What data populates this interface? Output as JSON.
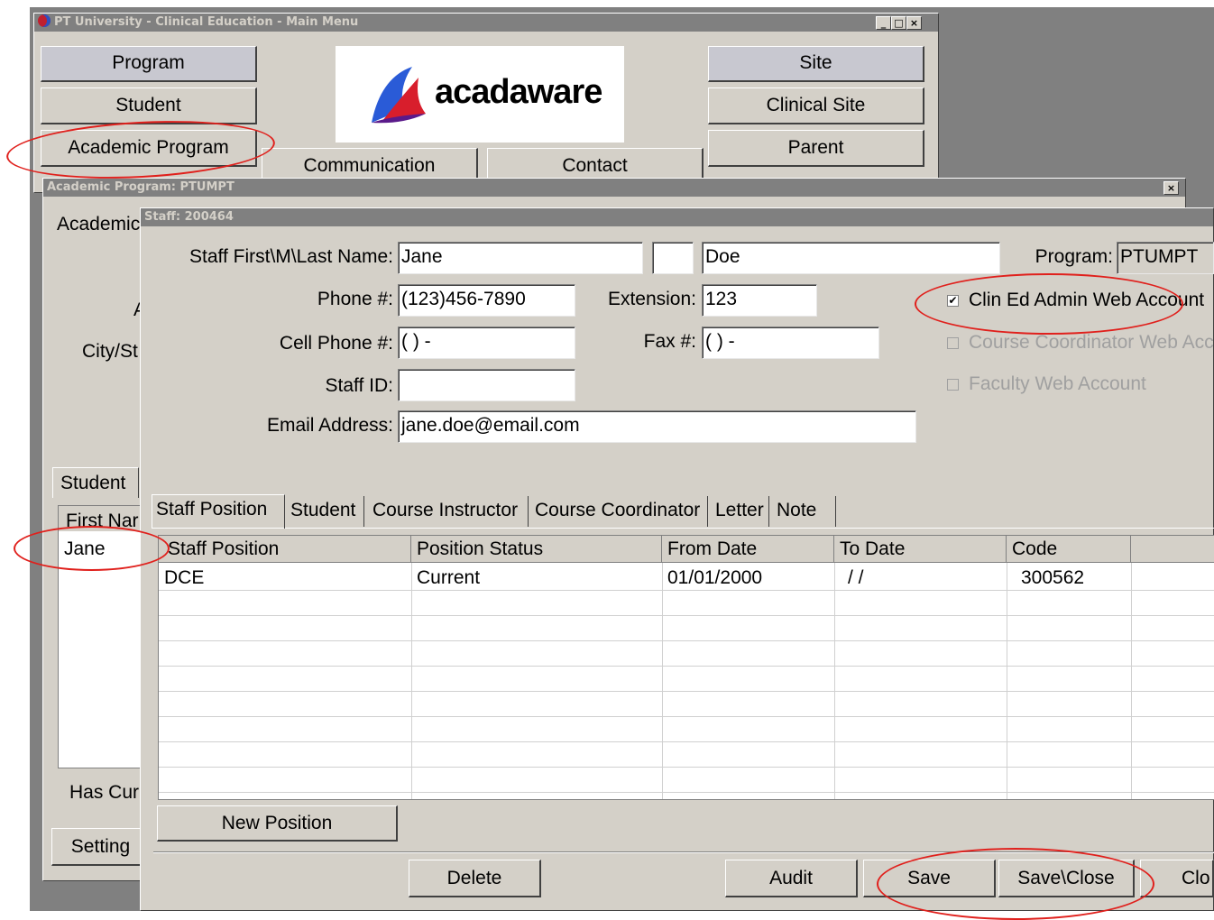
{
  "main_window": {
    "title": "PT University - Clinical Education - Main Menu",
    "buttons": {
      "program": "Program",
      "student": "Student",
      "academic_program": "Academic Program",
      "communication": "Communication",
      "contact": "Contact",
      "site": "Site",
      "clinical_site": "Clinical Site",
      "parent": "Parent"
    },
    "logo_text": "acadaware"
  },
  "academic_window": {
    "title": "Academic Program: PTUMPT",
    "labels": {
      "academic": "Academic",
      "a": "A",
      "city_state": "City/St",
      "has_current": "Has Cur"
    },
    "tab_student": "Student",
    "list_header": "First Nar",
    "list_rows": [
      "Jane"
    ],
    "settings_button": "Setting"
  },
  "staff_window": {
    "title": "Staff: 200464",
    "labels": {
      "name": "Staff First\\M\\Last Name:",
      "program": "Program:",
      "phone": "Phone #:",
      "extension": "Extension:",
      "cell": "Cell Phone #:",
      "fax": "Fax #:",
      "staff_id": "Staff ID:",
      "email": "Email Address:"
    },
    "values": {
      "first_name": "Jane",
      "middle": "",
      "last_name": "Doe",
      "program": "PTUMPT",
      "phone": "(123)456-7890",
      "extension": "123",
      "cell": "(  )   -",
      "fax": "(  )   -",
      "staff_id": "",
      "email": "jane.doe@email.com"
    },
    "checkboxes": [
      {
        "label": "Clin Ed Admin Web Account",
        "checked": true,
        "enabled": true
      },
      {
        "label": "Course Coordinator Web Acc",
        "checked": false,
        "enabled": false
      },
      {
        "label": "Faculty Web Account",
        "checked": false,
        "enabled": false
      }
    ],
    "tabs": [
      "Staff Position",
      "Student",
      "Course Instructor",
      "Course Coordinator",
      "Letter",
      "Note"
    ],
    "grid": {
      "columns": [
        "Staff Position",
        "Position Status",
        "From Date",
        "To Date",
        "Code"
      ],
      "rows": [
        [
          "DCE",
          "Current",
          "01/01/2000",
          " / /",
          "300562"
        ]
      ]
    },
    "buttons": {
      "new_position": "New Position",
      "delete": "Delete",
      "audit": "Audit",
      "save": "Save",
      "save_close": "Save\\Close",
      "close": "Clo"
    }
  },
  "colors": {
    "window_bg": "#d4d0c8",
    "desktop": "#808080",
    "annotation": "#e0201c"
  }
}
